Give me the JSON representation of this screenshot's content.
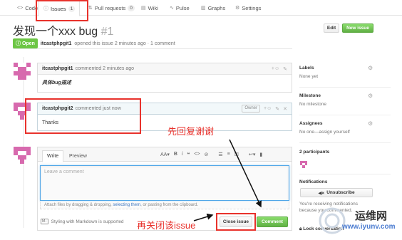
{
  "nav": {
    "code": "Code",
    "issues": "Issues",
    "issues_count": "1",
    "pulls": "Pull requests",
    "pulls_count": "0",
    "wiki": "Wiki",
    "pulse": "Pulse",
    "graphs": "Graphs",
    "settings": "Settings"
  },
  "issue": {
    "title": "发现一个xxx bug",
    "number": "#1",
    "edit_label": "Edit",
    "new_issue_label": "New issue",
    "status": "Open",
    "author": "itcastphpgit1",
    "opened_text": "opened this issue 2 minutes ago · 1 comment"
  },
  "comments": [
    {
      "author": "itcastphpgit1",
      "time": "commented 2 minutes ago",
      "body": "具体bug描述"
    },
    {
      "author": "itcastphpgit2",
      "time": "commented just now",
      "owner_badge": "Owner",
      "body": "Thanks"
    }
  ],
  "editor": {
    "write_tab": "Write",
    "preview_tab": "Preview",
    "placeholder": "Leave a comment",
    "attach_text_1": "Attach files by dragging & dropping, ",
    "attach_link": "selecting them",
    "attach_text_2": ", or pasting from the clipboard.",
    "markdown_note": "Styling with Markdown is supported",
    "close_issue_label": "Close issue",
    "comment_label": "Comment"
  },
  "sidebar": {
    "labels_title": "Labels",
    "labels_value": "None yet",
    "milestone_title": "Milestone",
    "milestone_value": "No milestone",
    "assignees_title": "Assignees",
    "assignees_value": "No one—assign yourself",
    "participants_title": "2 participants",
    "notifications_title": "Notifications",
    "unsubscribe_label": "Unsubscribe",
    "notif_text_1": "You're receiving notifications",
    "notif_text_2": "because you commented.",
    "lock_text": "Lock conversation"
  },
  "annotations": {
    "reply_first": "先回复谢谢",
    "then_close": "再关闭该issue"
  },
  "watermark": {
    "text": "运维网",
    "url": "www.iyunv.com"
  },
  "colors": {
    "accent_green": "#6cc644",
    "annotation_red": "#e8322c",
    "avatar_pink": "#d76aae",
    "link_blue": "#4078c0"
  }
}
